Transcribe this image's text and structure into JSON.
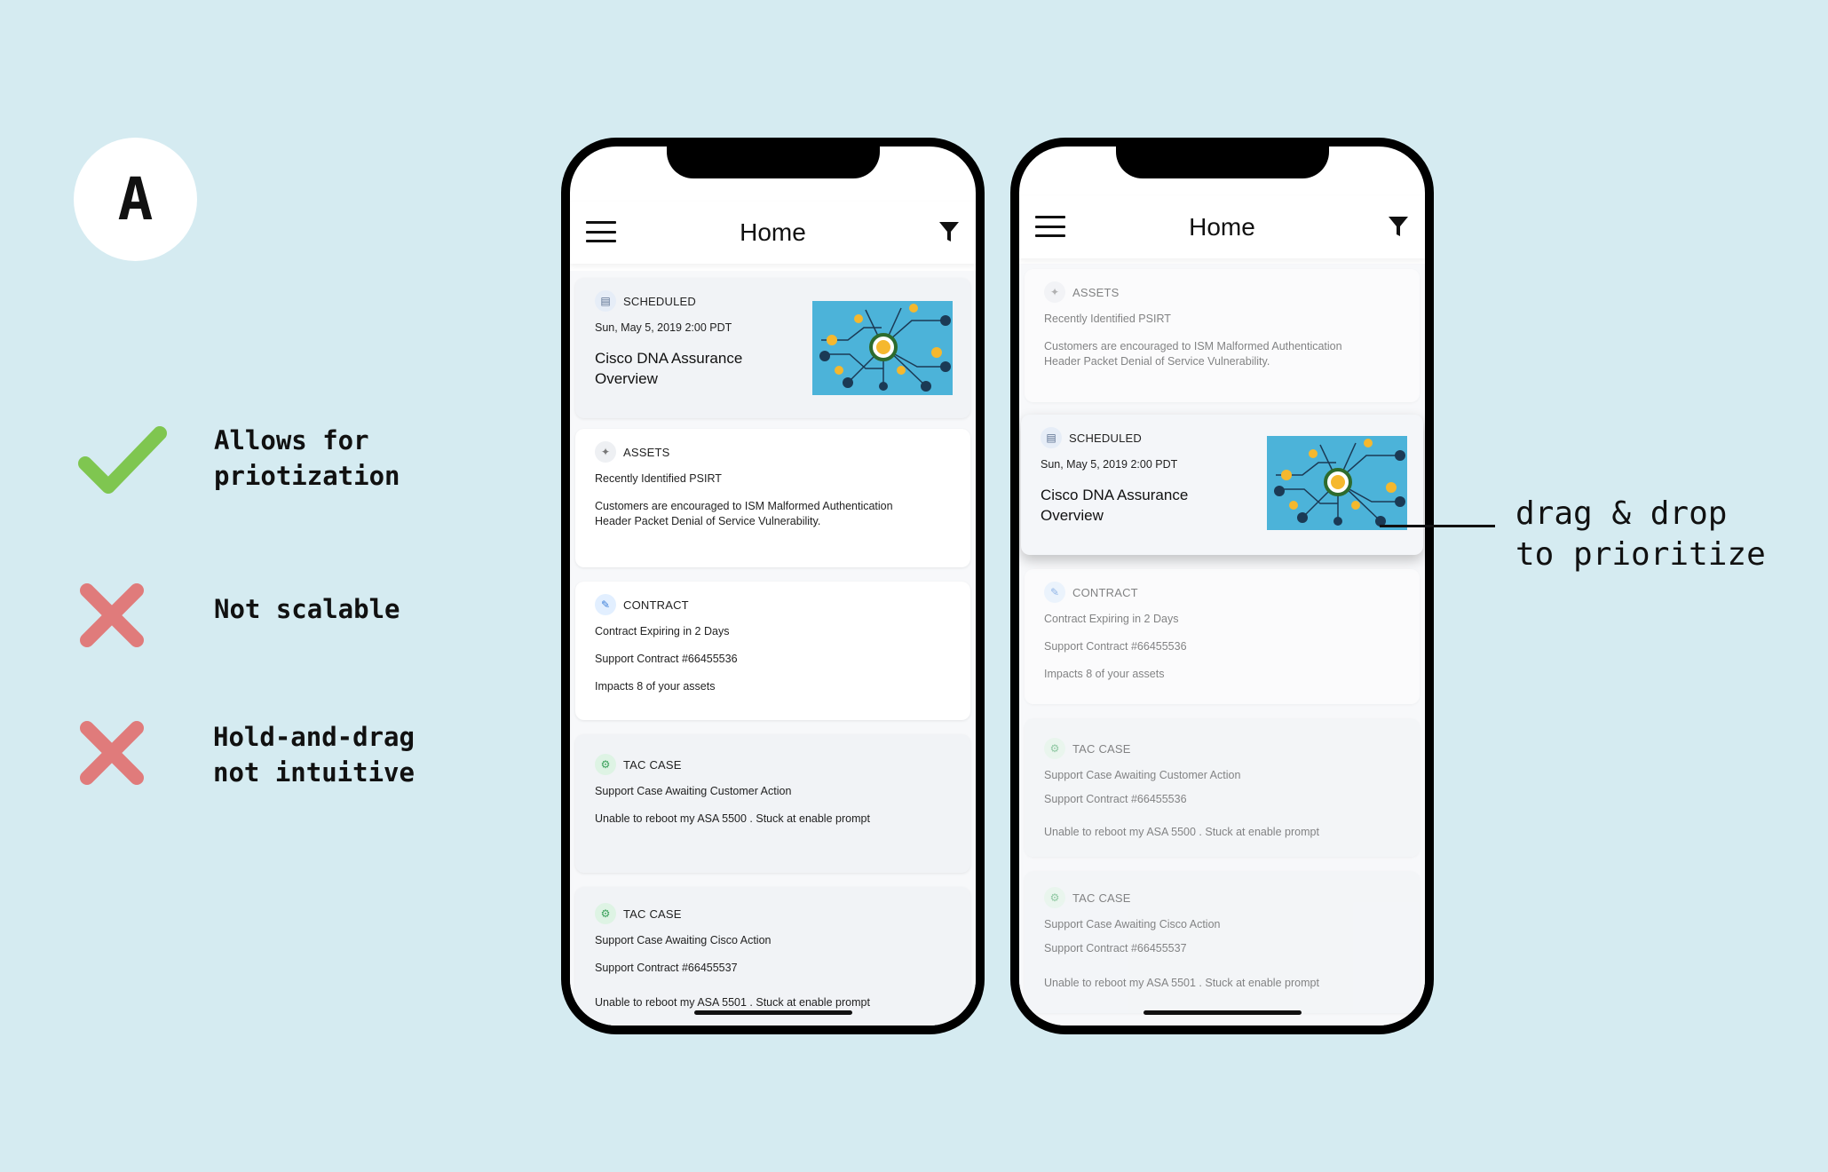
{
  "variant": {
    "label": "A"
  },
  "criteria": [
    {
      "mark": "check",
      "text": "Allows for\npriotization",
      "color": "#7fc650"
    },
    {
      "mark": "cross",
      "text": "Not scalable",
      "color": "#e07b7b"
    },
    {
      "mark": "cross",
      "text": "Hold-and-drag\nnot intuitive",
      "color": "#e07b7b"
    }
  ],
  "annotation": {
    "text": "drag & drop\nto prioritize"
  },
  "phone1": {
    "title": "Home",
    "cards": [
      {
        "type": "SCHEDULED",
        "date": "Sun, May 5, 2019 2:00 PDT",
        "title": "Cisco DNA Assurance\nOverview"
      },
      {
        "type": "ASSETS",
        "line1": "Recently Identified PSIRT",
        "line2": "Customers are encouraged to ISM Malformed Authentication\nHeader Packet Denial of Service Vulnerability."
      },
      {
        "type": "CONTRACT",
        "line1": "Contract Expiring in 2 Days",
        "line2": "Support Contract #66455536",
        "line3": "Impacts 8 of your assets"
      },
      {
        "type": "TAC CASE",
        "line1": "Support Case Awaiting Customer Action",
        "line2": "Unable to reboot my ASA 5500 . Stuck at enable prompt"
      },
      {
        "type": "TAC CASE",
        "line1": "Support Case Awaiting Cisco Action",
        "line2": "Support Contract #66455537",
        "line3": "Unable to reboot my ASA 5501 . Stuck at enable prompt"
      }
    ]
  },
  "phone2": {
    "title": "Home",
    "cards": [
      {
        "type": "ASSETS",
        "line1": "Recently Identified PSIRT",
        "line2": "Customers are encouraged to ISM Malformed Authentication\nHeader Packet Denial of Service Vulnerability."
      },
      {
        "type": "SCHEDULED",
        "date": "Sun, May 5, 2019 2:00 PDT",
        "title": "Cisco DNA Assurance\nOverview"
      },
      {
        "type": "CONTRACT",
        "line1": "Contract Expiring in 2 Days",
        "line2": "Support Contract #66455536",
        "line3": "Impacts 8 of your assets"
      },
      {
        "type": "TAC CASE",
        "line1": "Support Case Awaiting Customer Action",
        "line2": "Support Contract #66455536",
        "line3": "Unable to reboot my ASA 5500 . Stuck at enable prompt"
      },
      {
        "type": "TAC CASE",
        "line1": "Support Case Awaiting Cisco Action",
        "line2": "Support Contract #66455537",
        "line3": "Unable to reboot my ASA 5501 . Stuck at enable prompt"
      }
    ]
  }
}
